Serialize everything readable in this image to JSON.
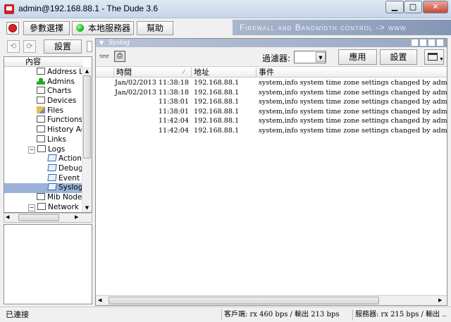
{
  "window": {
    "title": "admin@192.168.88.1 - The Dude 3.6",
    "min_label": "▁",
    "max_label": "□",
    "close_label": "✕"
  },
  "toolbar": {
    "prefs_label": "參數選擇",
    "local_server_label": "本地服務器",
    "help_label": "幫助",
    "banner": "Firewall and Bandwidth control -> www"
  },
  "left": {
    "settings_label": "設置",
    "tree_header": "內容",
    "tree": [
      "Address Lists",
      "Admins",
      "Charts",
      "Devices",
      "Files",
      "Functions",
      "History Actions",
      "Links",
      "Logs",
      "Action",
      "Debug",
      "Event",
      "Syslog",
      "Mib Nodes",
      "Network Maps"
    ],
    "selected": "Syslog"
  },
  "right": {
    "tab_title": "Syslog",
    "filter_label": "過濾器:",
    "apply_label": "應用",
    "settings_label": "設置",
    "columns": [
      "時間",
      "地址",
      "事件"
    ],
    "rows": [
      {
        "time": "Jan/02/2013 11:38:18",
        "address": "192.168.88.1",
        "event": "system,info system time zone settings changed by admin"
      },
      {
        "time": "Jan/02/2013 11:38:18",
        "address": "192.168.88.1",
        "event": "system,info system time zone settings changed by admin"
      },
      {
        "time": "11:38:01",
        "address": "192.168.88.1",
        "event": "system,info system time zone settings changed by admin"
      },
      {
        "time": "11:38:01",
        "address": "192.168.88.1",
        "event": "system,info system time zone settings changed by admin"
      },
      {
        "time": "11:42:04",
        "address": "192.168.88.1",
        "event": "system,info system time zone settings changed by admin"
      },
      {
        "time": "11:42:04",
        "address": "192.168.88.1",
        "event": "system,info system time zone settings changed by admin"
      }
    ]
  },
  "status": {
    "connection": "已連接",
    "client": "客戶端: rx 460 bps / 輸出 213 bps",
    "server": "服務器: rx 215 bps / 輸出 ..."
  },
  "colors": {
    "title_bg": "#c6d6ea",
    "selected_row": "#9bb3d8",
    "banner": "#8496b5",
    "close": "#c74a35"
  }
}
